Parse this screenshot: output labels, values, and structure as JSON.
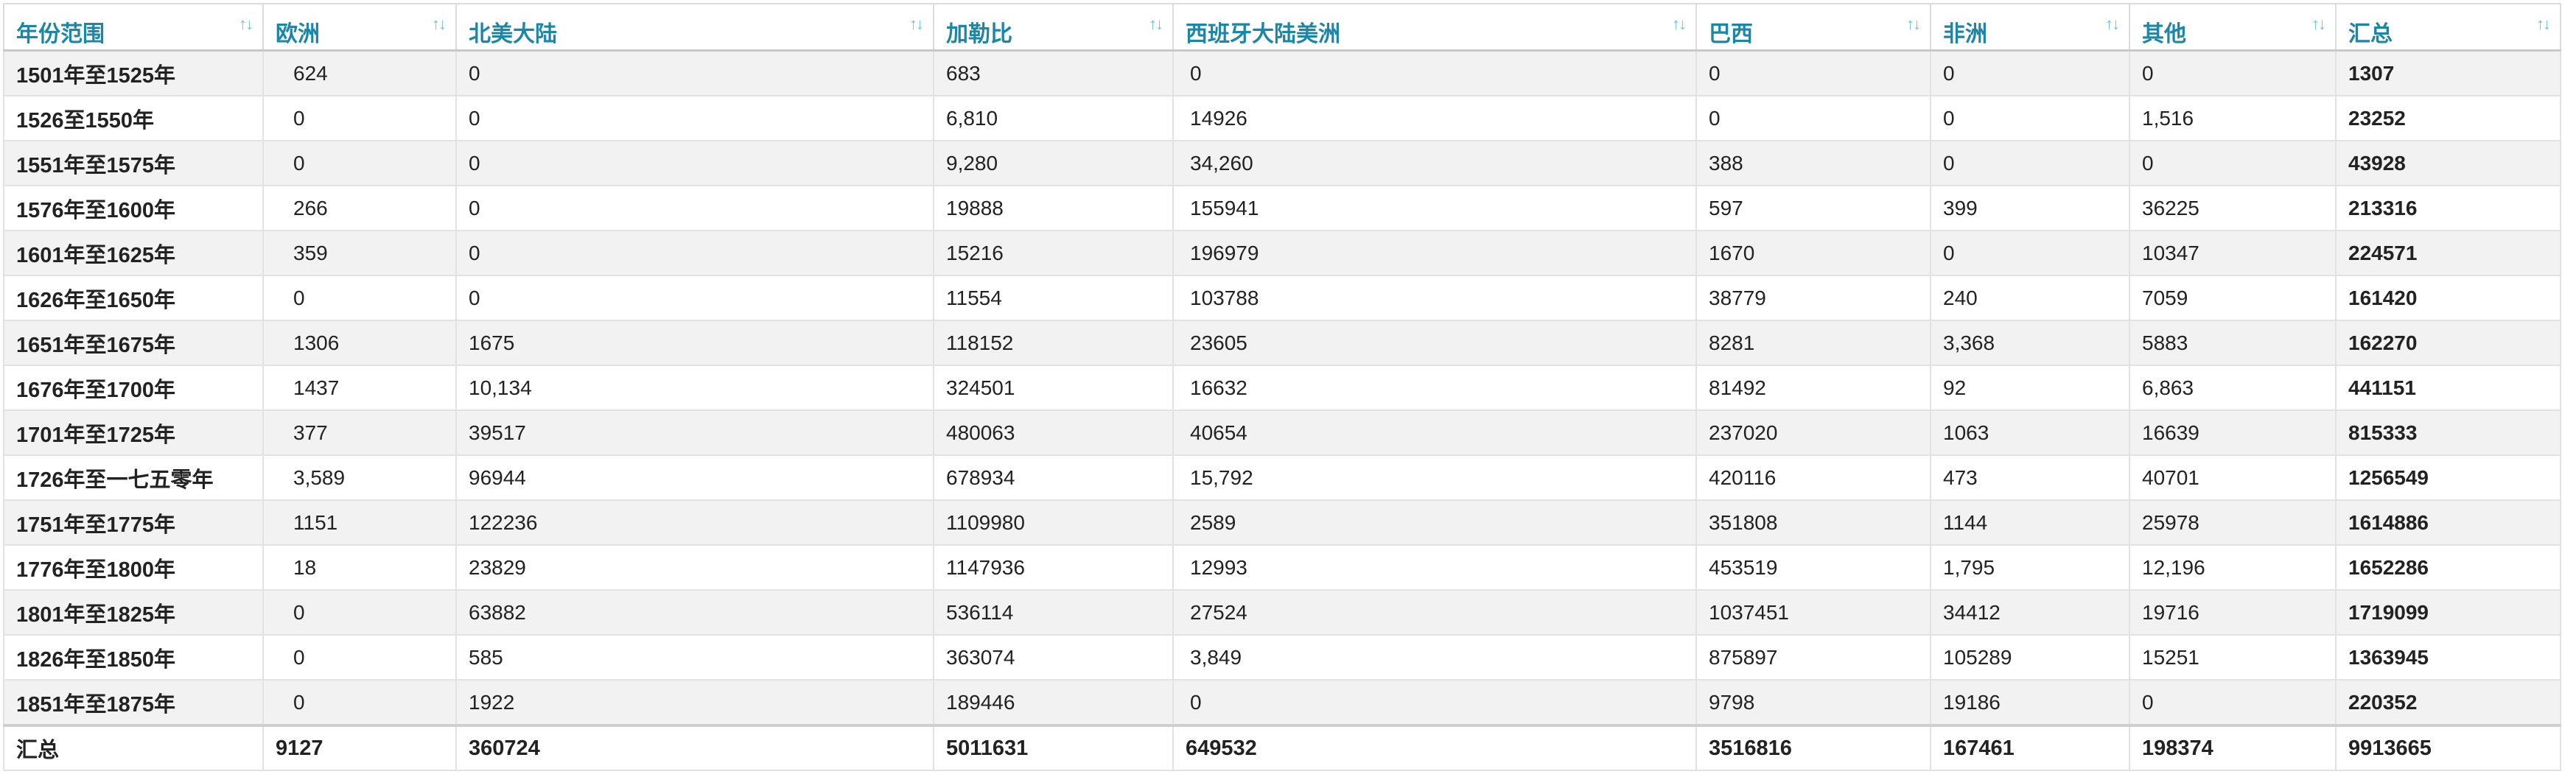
{
  "headers": [
    "年份范围",
    "欧洲",
    "北美大陆",
    "加勒比",
    "西班牙大陆美洲",
    "巴西",
    "非洲",
    "其他",
    "汇总"
  ],
  "sort_icon": "↑↓",
  "rows": [
    [
      "1501年至1525年",
      "624",
      "0",
      "683",
      "0",
      "0",
      "0",
      "0",
      "1307"
    ],
    [
      "1526至1550年",
      "0",
      "0",
      "6,810",
      "14926",
      "0",
      "0",
      "1,516",
      "23252"
    ],
    [
      "1551年至1575年",
      "0",
      "0",
      "9,280",
      "34,260",
      "388",
      "0",
      "0",
      "43928"
    ],
    [
      "1576年至1600年",
      "266",
      "0",
      "19888",
      "155941",
      "597",
      "399",
      "36225",
      "213316"
    ],
    [
      "1601年至1625年",
      "359",
      "0",
      "15216",
      "196979",
      "1670",
      "0",
      "10347",
      "224571"
    ],
    [
      "1626年至1650年",
      "0",
      "0",
      "11554",
      "103788",
      "38779",
      "240",
      "7059",
      "161420"
    ],
    [
      "1651年至1675年",
      "1306",
      "1675",
      "118152",
      "23605",
      "8281",
      "3,368",
      "5883",
      "162270"
    ],
    [
      "1676年至1700年",
      "1437",
      "10,134",
      "324501",
      "16632",
      "81492",
      "92",
      "6,863",
      "441151"
    ],
    [
      "1701年至1725年",
      "377",
      "39517",
      "480063",
      "40654",
      "237020",
      "1063",
      "16639",
      "815333"
    ],
    [
      "1726年至一七五零年",
      "3,589",
      "96944",
      "678934",
      "15,792",
      "420116",
      "473",
      "40701",
      "1256549"
    ],
    [
      "1751年至1775年",
      "1151",
      "122236",
      "1109980",
      "2589",
      "351808",
      "1144",
      "25978",
      "1614886"
    ],
    [
      "1776年至1800年",
      "18",
      "23829",
      "1147936",
      "12993",
      "453519",
      "1,795",
      "12,196",
      "1652286"
    ],
    [
      "1801年至1825年",
      "0",
      "63882",
      "536114",
      "27524",
      "1037451",
      "34412",
      "19716",
      "1719099"
    ],
    [
      "1826年至1850年",
      "0",
      "585",
      "363074",
      "3,849",
      "875897",
      "105289",
      "15251",
      "1363945"
    ],
    [
      "1851年至1875年",
      "0",
      "1922",
      "189446",
      "0",
      "9798",
      "19186",
      "0",
      "220352"
    ]
  ],
  "footer": [
    "汇总",
    "9127",
    "360724",
    "5011631",
    "649532",
    "3516816",
    "167461",
    "198374",
    "9913665"
  ],
  "colors": {
    "header_text": "#1a87a8",
    "sort_icon": "#6fc3d6",
    "row_stripe": "#f2f2f2",
    "border": "#e2e2e2"
  }
}
